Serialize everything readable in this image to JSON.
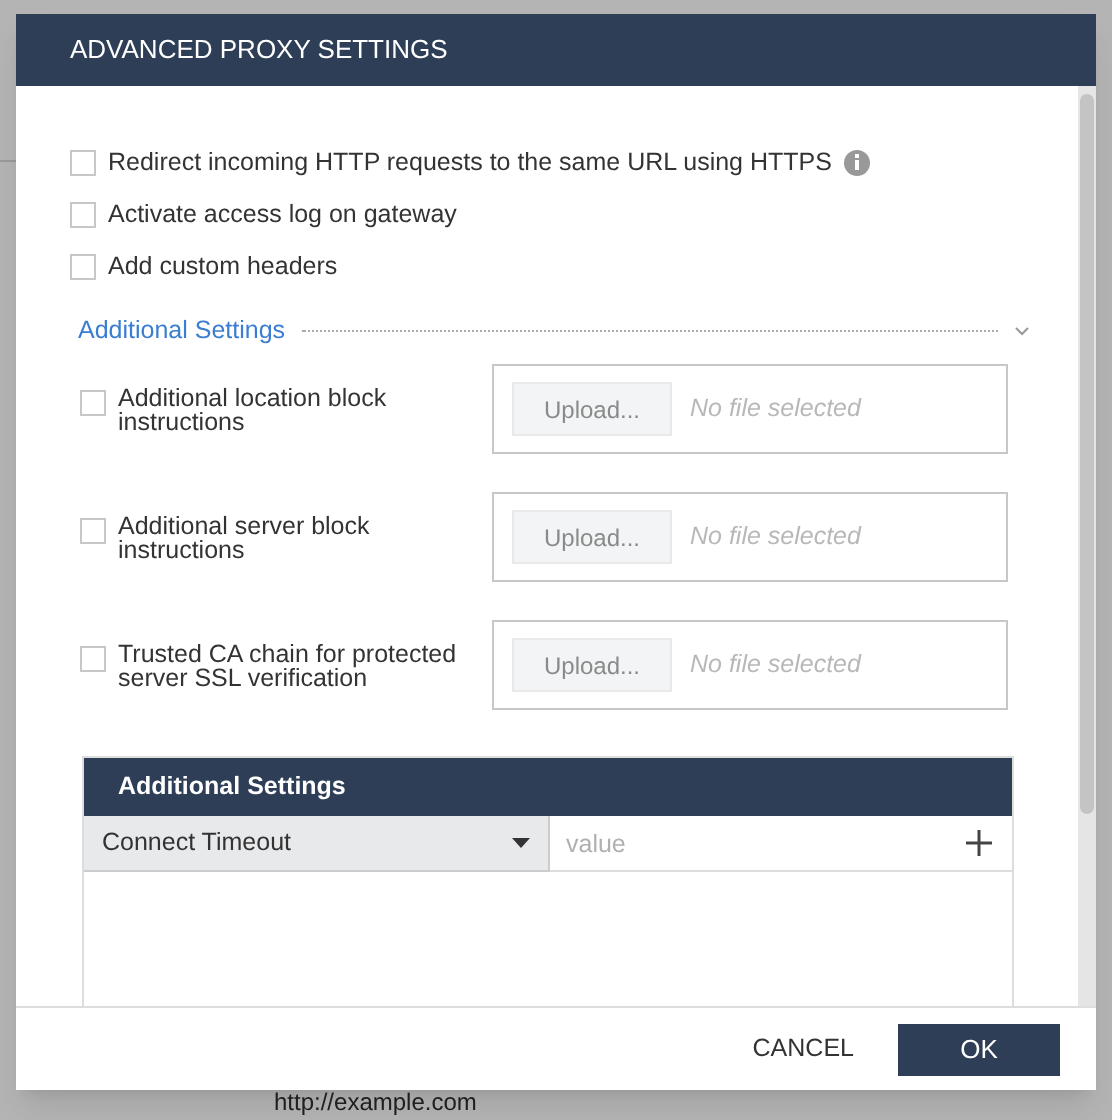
{
  "dialog": {
    "title": "ADVANCED PROXY SETTINGS"
  },
  "options": [
    {
      "label": "Redirect incoming HTTP requests to the same URL using HTTPS",
      "checked": false,
      "info": true
    },
    {
      "label": "Activate access log on gateway",
      "checked": false,
      "info": false
    },
    {
      "label": "Add custom headers",
      "checked": false,
      "info": false
    }
  ],
  "section": {
    "label": "Additional Settings",
    "expanded": false
  },
  "uploads": [
    {
      "label": "Additional location block instructions",
      "checked": false,
      "button": "Upload...",
      "file": "No file selected"
    },
    {
      "label": "Additional server block instructions",
      "checked": false,
      "button": "Upload...",
      "file": "No file selected"
    },
    {
      "label": "Trusted CA chain for protected server SSL verification",
      "checked": false,
      "button": "Upload...",
      "file": "No file selected"
    }
  ],
  "settings_table": {
    "title": "Additional Settings",
    "select": "Connect Timeout",
    "value_placeholder": "value"
  },
  "buttons": {
    "cancel": "CANCEL",
    "ok": "OK"
  },
  "background": {
    "link": "http://example.com"
  }
}
